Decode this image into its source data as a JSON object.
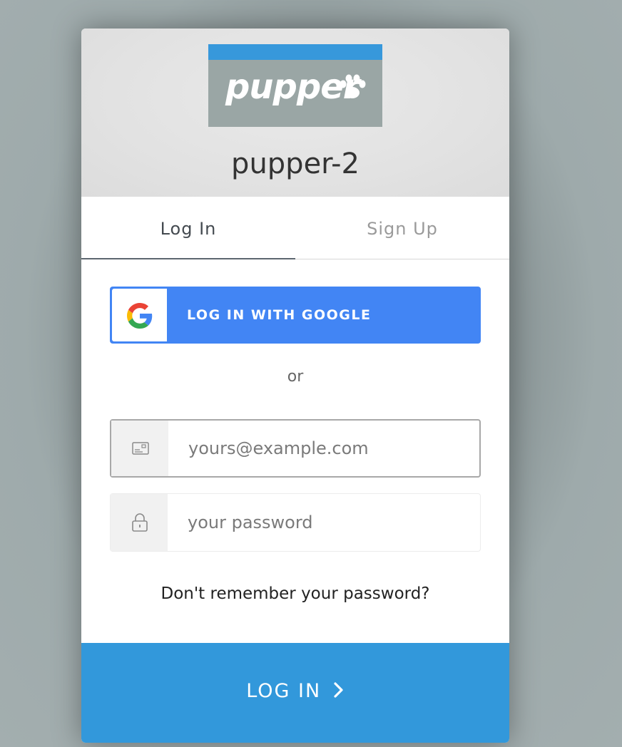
{
  "app": {
    "logo_text": "pupper",
    "title": "pupper-2"
  },
  "tabs": [
    {
      "label": "Log In",
      "active": true
    },
    {
      "label": "Sign Up",
      "active": false
    }
  ],
  "social": {
    "google_label": "LOG IN WITH GOOGLE"
  },
  "divider_text": "or",
  "form": {
    "email_placeholder": "yours@example.com",
    "email_value": "",
    "password_placeholder": "your password",
    "password_value": ""
  },
  "forgot_link": "Don't remember your password?",
  "submit_label": "LOG IN",
  "colors": {
    "brand_blue": "#3298db",
    "google_blue": "#4285f4",
    "logo_bg": "#9aa6a5"
  },
  "icons": {
    "email": "envelope-icon",
    "password": "lock-icon",
    "google": "google-icon",
    "submit": "chevron-right-icon",
    "logo": "paw-icon"
  }
}
